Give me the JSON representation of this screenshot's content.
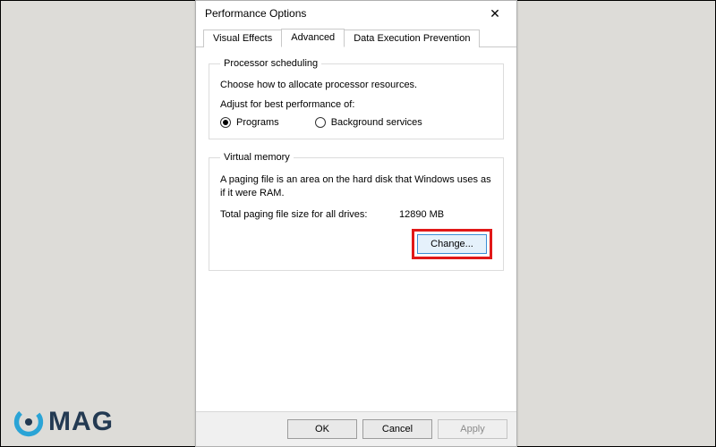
{
  "window": {
    "title": "Performance Options",
    "close_glyph": "✕"
  },
  "tabs": [
    {
      "label": "Visual Effects",
      "active": false
    },
    {
      "label": "Advanced",
      "active": true
    },
    {
      "label": "Data Execution Prevention",
      "active": false
    }
  ],
  "processor_scheduling": {
    "legend": "Processor scheduling",
    "description": "Choose how to allocate processor resources.",
    "sublabel": "Adjust for best performance of:",
    "options": {
      "programs": {
        "label": "Programs",
        "checked": true
      },
      "background": {
        "label": "Background services",
        "checked": false
      }
    }
  },
  "virtual_memory": {
    "legend": "Virtual memory",
    "description": "A paging file is an area on the hard disk that Windows uses as if it were RAM.",
    "total_label": "Total paging file size for all drives:",
    "total_value": "12890 MB",
    "change_button": "Change..."
  },
  "footer": {
    "ok": "OK",
    "cancel": "Cancel",
    "apply": "Apply"
  },
  "watermark": {
    "text": "MAG"
  }
}
